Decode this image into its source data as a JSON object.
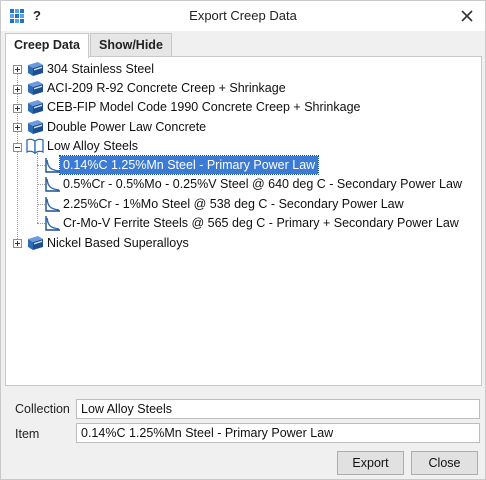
{
  "window": {
    "title": "Export Creep Data",
    "help_label": "?"
  },
  "tabs": [
    {
      "label": "Creep Data",
      "active": true
    },
    {
      "label": "Show/Hide",
      "active": false
    }
  ],
  "tree": {
    "nodes": [
      {
        "label": "304 Stainless Steel",
        "expanded": false
      },
      {
        "label": "ACI-209 R-92 Concrete Creep + Shrinkage",
        "expanded": false
      },
      {
        "label": "CEB-FIP Model Code 1990 Concrete Creep + Shrinkage",
        "expanded": false
      },
      {
        "label": "Double Power Law Concrete",
        "expanded": false
      },
      {
        "label": "Low Alloy Steels",
        "expanded": true,
        "children": [
          {
            "label": "0.14%C 1.25%Mn Steel - Primary Power Law",
            "selected": true
          },
          {
            "label": "0.5%Cr - 0.5%Mo - 0.25%V Steel @ 640 deg C - Secondary Power Law",
            "selected": false
          },
          {
            "label": "2.25%Cr - 1%Mo Steel @ 538 deg C - Secondary Power Law",
            "selected": false
          },
          {
            "label": "Cr-Mo-V Ferrite Steels @ 565 deg C - Primary + Secondary Power Law",
            "selected": false
          }
        ]
      },
      {
        "label": "Nickel Based Superalloys",
        "expanded": false
      }
    ]
  },
  "fields": {
    "collection_label": "Collection",
    "collection_value": "Low Alloy Steels",
    "item_label": "Item",
    "item_value": "0.14%C 1.25%Mn Steel - Primary Power Law"
  },
  "buttons": {
    "export_label": "Export",
    "close_label": "Close"
  },
  "colors": {
    "selection": "#3b7bd4",
    "book_blue": "#2f6bb3",
    "app_icon": "#1e73c8"
  }
}
